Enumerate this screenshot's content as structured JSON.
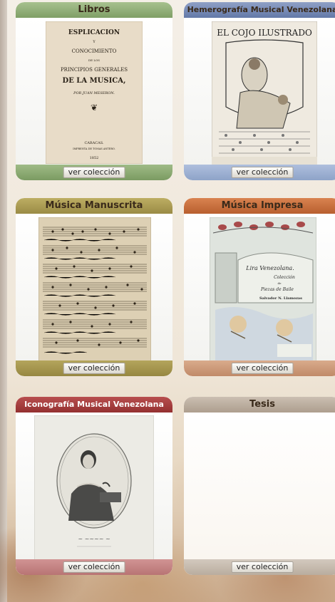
{
  "cards": [
    {
      "title": "Libros",
      "button": "ver colección",
      "header_color": "#8fae76",
      "footer_color": "#8fae76"
    },
    {
      "title": "Hemerografía Musical Venezolana",
      "button": "ver colección",
      "header_color": "#7b8fb8",
      "footer_color": "#9aaed0"
    },
    {
      "title": "Música Manuscrita",
      "button": "ver colección",
      "header_color": "#a99b52",
      "footer_color": "#a99b52"
    },
    {
      "title": "Música Impresa",
      "button": "ver colección",
      "header_color": "#c9703f",
      "footer_color": "#cf9a78"
    },
    {
      "title": "Iconografía Musical Venezolana",
      "button": "ver colección",
      "header_color": "#a93f3f",
      "footer_color": "#c98585"
    },
    {
      "title": "Tesis",
      "button": "ver colección",
      "header_color": "#b8aa9c",
      "footer_color": "#c8bfb3"
    }
  ],
  "book_cover": {
    "line1": "ESPLICACION",
    "line2": "Y",
    "line3": "CONOCIMIENTO",
    "line4": "DE LOS",
    "line5": "PRINCIPIOS GENERALES",
    "line6": "DE LA MUSICA,",
    "line7": "POR JUAN MESERON.",
    "line8": "CARACAS.",
    "line9": "IMPRENTA DE TOMAS ANTERO.",
    "line10": "1852"
  },
  "magazine_title": "EL COJO ILUSTRADO",
  "print_cover": {
    "line1": "Lira Venezolana.",
    "line2": "Colección",
    "line3": "de",
    "line4": "Piezas de Baile",
    "line5": "Salvador N. Llamozas"
  }
}
